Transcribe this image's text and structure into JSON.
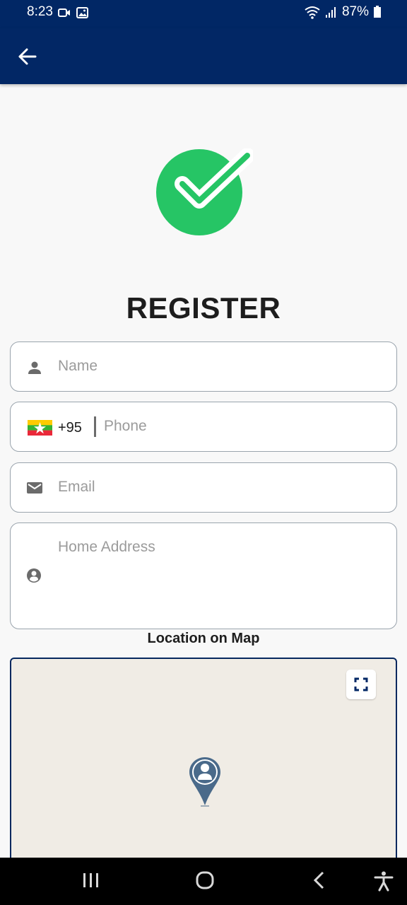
{
  "status_bar": {
    "time": "8:23",
    "battery": "87%",
    "icons_left": [
      "video-call-icon",
      "image-icon"
    ],
    "icons_right": [
      "wifi-icon",
      "signal-icon",
      "battery-icon"
    ]
  },
  "app_bar": {
    "back_icon": "arrow-left-icon"
  },
  "title": "REGISTER",
  "form": {
    "name_placeholder": "Name",
    "phone_dial_code": "+95",
    "phone_placeholder": "Phone",
    "email_placeholder": "Email",
    "address_placeholder": "Home Address",
    "map_label": "Location on Map"
  },
  "colors": {
    "primary": "#022765",
    "accent_green": "#26c565",
    "pin": "#4a6a8a",
    "map_bg": "#f0ece5"
  }
}
